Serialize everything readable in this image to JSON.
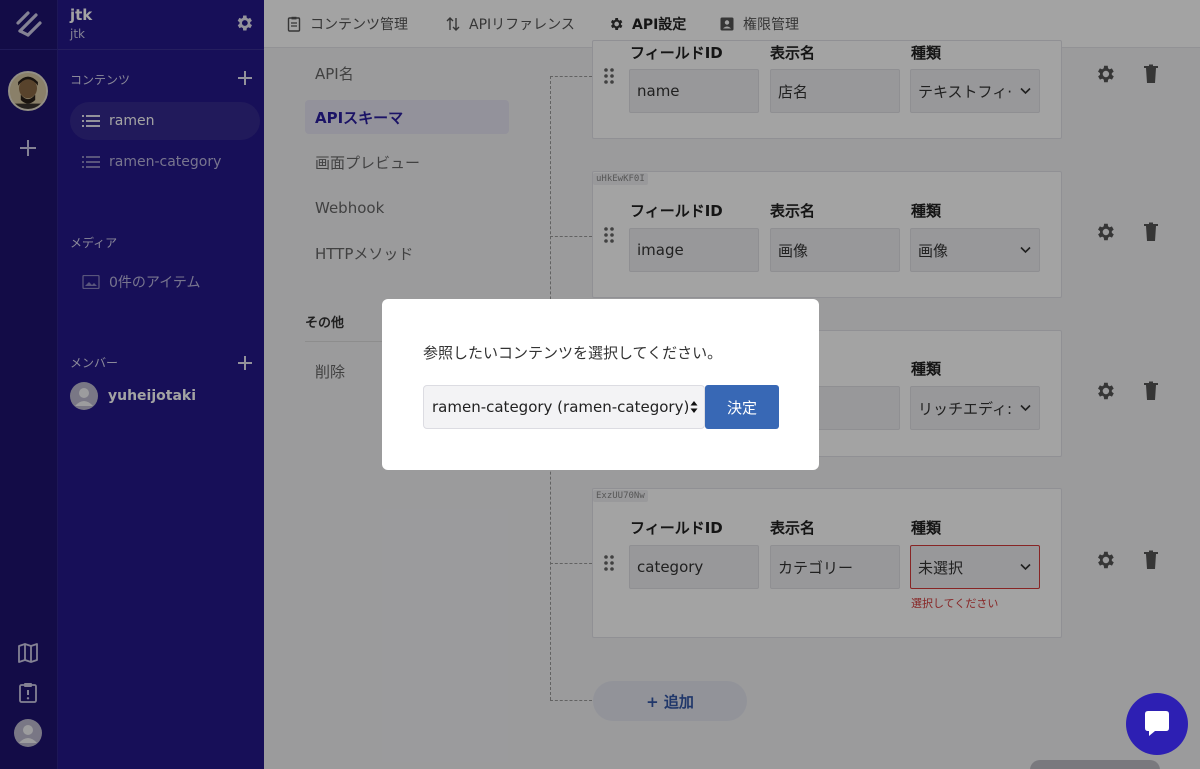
{
  "rail": {
    "icons": [
      "logo-icon",
      "avatar",
      "add-icon",
      "map-icon",
      "alert-icon",
      "user-icon"
    ]
  },
  "sidebar": {
    "title": "jtk",
    "subtitle": "jtk",
    "contents_label": "コンテンツ",
    "items": [
      {
        "label": "ramen",
        "active": true
      },
      {
        "label": "ramen-category",
        "active": false
      }
    ],
    "media_label": "メディア",
    "media_item": "0件のアイテム",
    "members_label": "メンバー",
    "member_name": "yuheijotaki"
  },
  "header": {
    "tabs": [
      {
        "label": "コンテンツ管理",
        "icon": "clipboard-icon",
        "active": false
      },
      {
        "label": "APIリファレンス",
        "icon": "arrows-updown-icon",
        "active": false
      },
      {
        "label": "API設定",
        "icon": "gear-icon",
        "active": true
      },
      {
        "label": "権限管理",
        "icon": "id-card-icon",
        "active": false
      }
    ]
  },
  "settings_nav": {
    "items": [
      {
        "label": "API名",
        "active": false
      },
      {
        "label": "APIスキーマ",
        "active": true
      },
      {
        "label": "画面プレビュー",
        "active": false
      },
      {
        "label": "Webhook",
        "active": false
      },
      {
        "label": "HTTPメソッド",
        "active": false
      }
    ],
    "other_heading": "その他",
    "delete_label": "削除"
  },
  "schema": {
    "labels": {
      "field_id": "フィールドID",
      "display_name": "表示名",
      "type": "種類"
    },
    "fields": [
      {
        "tag": "",
        "field_id": "name",
        "display_name": "店名",
        "type": "テキストフィ·"
      },
      {
        "tag": "uHkEwKF0I",
        "field_id": "image",
        "display_name": "画像",
        "type": "画像"
      },
      {
        "tag": "",
        "field_id": "",
        "display_name": "",
        "type": "リッチエディ:"
      },
      {
        "tag": "ExzUU70Nw",
        "field_id": "category",
        "display_name": "カテゴリー",
        "type": "未選択",
        "error": "選択してください"
      }
    ],
    "add_label": "+ 追加"
  },
  "modal": {
    "message": "参照したいコンテンツを選択してください。",
    "select_value": "ramen-category (ramen-category)",
    "confirm_label": "決定"
  },
  "colors": {
    "sidebar": "#24188a",
    "rail": "#1f1470",
    "accent_tab": "#e85c1f",
    "primary_button": "#3868b5",
    "error": "#d43b3b",
    "chat": "#2d1fb3"
  }
}
